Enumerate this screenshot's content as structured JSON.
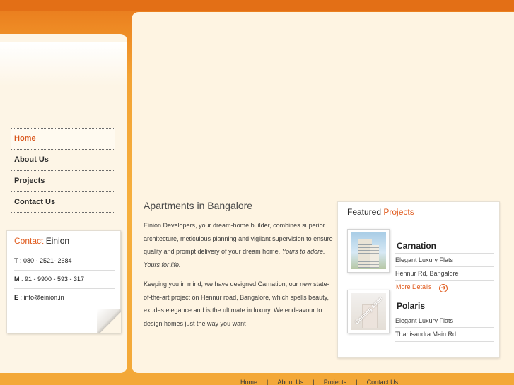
{
  "nav": {
    "items": [
      {
        "label": "Home"
      },
      {
        "label": "About Us"
      },
      {
        "label": "Projects"
      },
      {
        "label": "Contact Us"
      }
    ]
  },
  "contact": {
    "title_highlight": "Contact",
    "title_rest": "Einion",
    "rows": [
      {
        "key": "T",
        "value": " : 080 - 2521- 2684"
      },
      {
        "key": "M",
        "value": " : 91 - 9900 - 593 - 317"
      },
      {
        "key": "E",
        "value": " : info@einion.in"
      }
    ]
  },
  "main": {
    "heading": "Apartments in Bangalore",
    "para1": "Einion Developers, your dream-home builder, combines superior architecture, meticulous planning and vigilant supervision to ensure quality and prompt delivery of your dream home.",
    "para1_em": "Yours to adore. Yours for life.",
    "para2": "Keeping you in mind, we have designed Carnation, our new state-of-the-art project on Hennur road, Bangalore, which spells beauty, exudes elegance and is the ultimate in luxury. We endeavour to design homes just the way you want"
  },
  "featured": {
    "title_dark": "Featured",
    "title_highlight": "Projects",
    "projects": [
      {
        "name": "Carnation",
        "line1": "Elegant Luxury Flats",
        "line2": "Hennur Rd, Bangalore",
        "more": "More Details"
      },
      {
        "name": "Polaris",
        "line1": "Elegant Luxury Flats",
        "line2": "Thanisandra Main Rd",
        "badge": "Coming soon"
      }
    ]
  },
  "footer": {
    "links": [
      "Home",
      "About Us",
      "Projects",
      "Contact Us"
    ],
    "separator": "|"
  },
  "colors": {
    "accent": "#e05a1c",
    "page_bg": "#f3a334",
    "panel_bg": "#fef4e2"
  }
}
